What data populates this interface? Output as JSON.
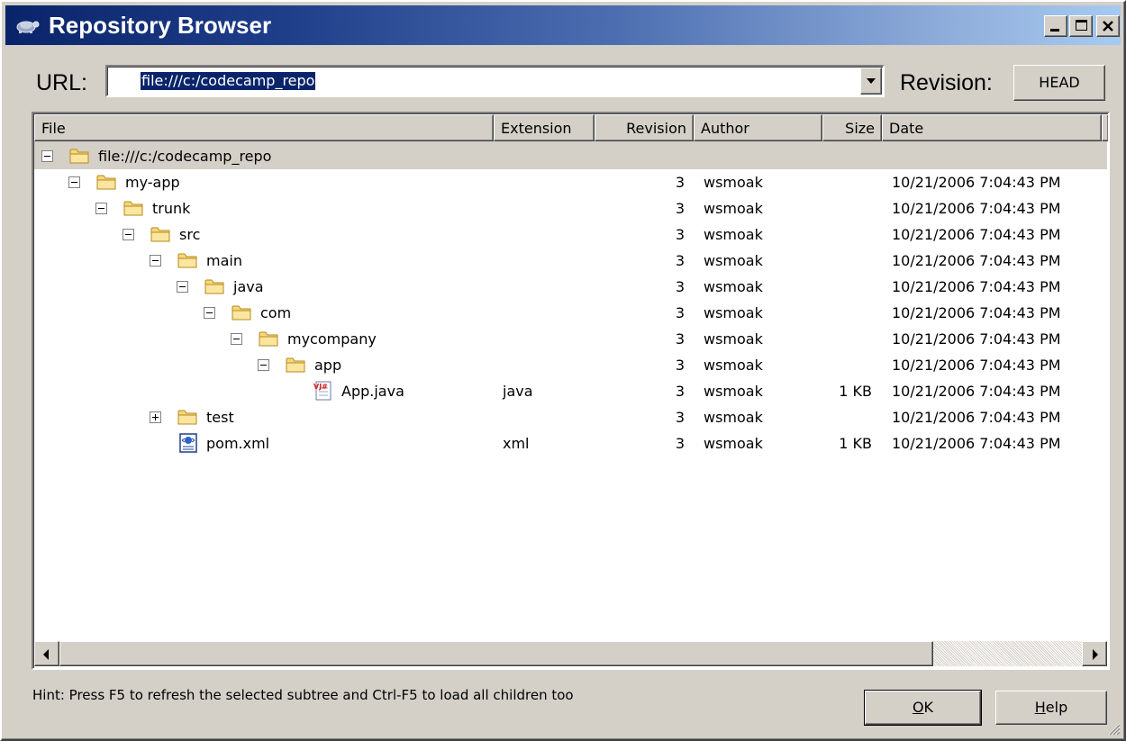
{
  "window": {
    "title": "Repository Browser"
  },
  "url_bar": {
    "label": "URL:",
    "value": "file:///c:/codecamp_repo"
  },
  "revision": {
    "label": "Revision:",
    "button_label": "HEAD"
  },
  "columns": [
    "File",
    "Extension",
    "Revision",
    "Author",
    "Size",
    "Date"
  ],
  "rows": [
    {
      "name": "file:///c:/codecamp_repo",
      "icon": "folder-icon",
      "expander": "minus",
      "extension": "",
      "revision": "",
      "author": "",
      "size": "",
      "date": ""
    },
    {
      "name": "my-app",
      "icon": "folder-icon",
      "expander": "minus",
      "extension": "",
      "revision": "3",
      "author": "wsmoak",
      "size": "",
      "date": "10/21/2006 7:04:43 PM"
    },
    {
      "name": "trunk",
      "icon": "folder-icon",
      "expander": "minus",
      "extension": "",
      "revision": "3",
      "author": "wsmoak",
      "size": "",
      "date": "10/21/2006 7:04:43 PM"
    },
    {
      "name": "src",
      "icon": "folder-icon",
      "expander": "minus",
      "extension": "",
      "revision": "3",
      "author": "wsmoak",
      "size": "",
      "date": "10/21/2006 7:04:43 PM"
    },
    {
      "name": "main",
      "icon": "folder-icon",
      "expander": "minus",
      "extension": "",
      "revision": "3",
      "author": "wsmoak",
      "size": "",
      "date": "10/21/2006 7:04:43 PM"
    },
    {
      "name": "java",
      "icon": "folder-icon",
      "expander": "minus",
      "extension": "",
      "revision": "3",
      "author": "wsmoak",
      "size": "",
      "date": "10/21/2006 7:04:43 PM"
    },
    {
      "name": "com",
      "icon": "folder-icon",
      "expander": "minus",
      "extension": "",
      "revision": "3",
      "author": "wsmoak",
      "size": "",
      "date": "10/21/2006 7:04:43 PM"
    },
    {
      "name": "mycompany",
      "icon": "folder-icon",
      "expander": "minus",
      "extension": "",
      "revision": "3",
      "author": "wsmoak",
      "size": "",
      "date": "10/21/2006 7:04:43 PM"
    },
    {
      "name": "app",
      "icon": "folder-icon",
      "expander": "minus",
      "extension": "",
      "revision": "3",
      "author": "wsmoak",
      "size": "",
      "date": "10/21/2006 7:04:43 PM"
    },
    {
      "name": "App.java",
      "icon": "java-file-icon",
      "expander": "none",
      "extension": "java",
      "revision": "3",
      "author": "wsmoak",
      "size": "1 KB",
      "date": "10/21/2006 7:04:43 PM"
    },
    {
      "name": "test",
      "icon": "folder-icon",
      "expander": "plus",
      "extension": "",
      "revision": "3",
      "author": "wsmoak",
      "size": "",
      "date": "10/21/2006 7:04:43 PM"
    },
    {
      "name": "pom.xml",
      "icon": "xml-file-icon",
      "expander": "none",
      "extension": "xml",
      "revision": "3",
      "author": "wsmoak",
      "size": "1 KB",
      "date": "10/21/2006 7:04:43 PM"
    }
  ],
  "hint": "Hint: Press F5 to refresh the selected subtree and Ctrl-F5 to load all children too",
  "buttons": {
    "ok_mnemonic": "O",
    "ok_rest": "K",
    "help_mnemonic": "H",
    "help_rest": "elp"
  }
}
